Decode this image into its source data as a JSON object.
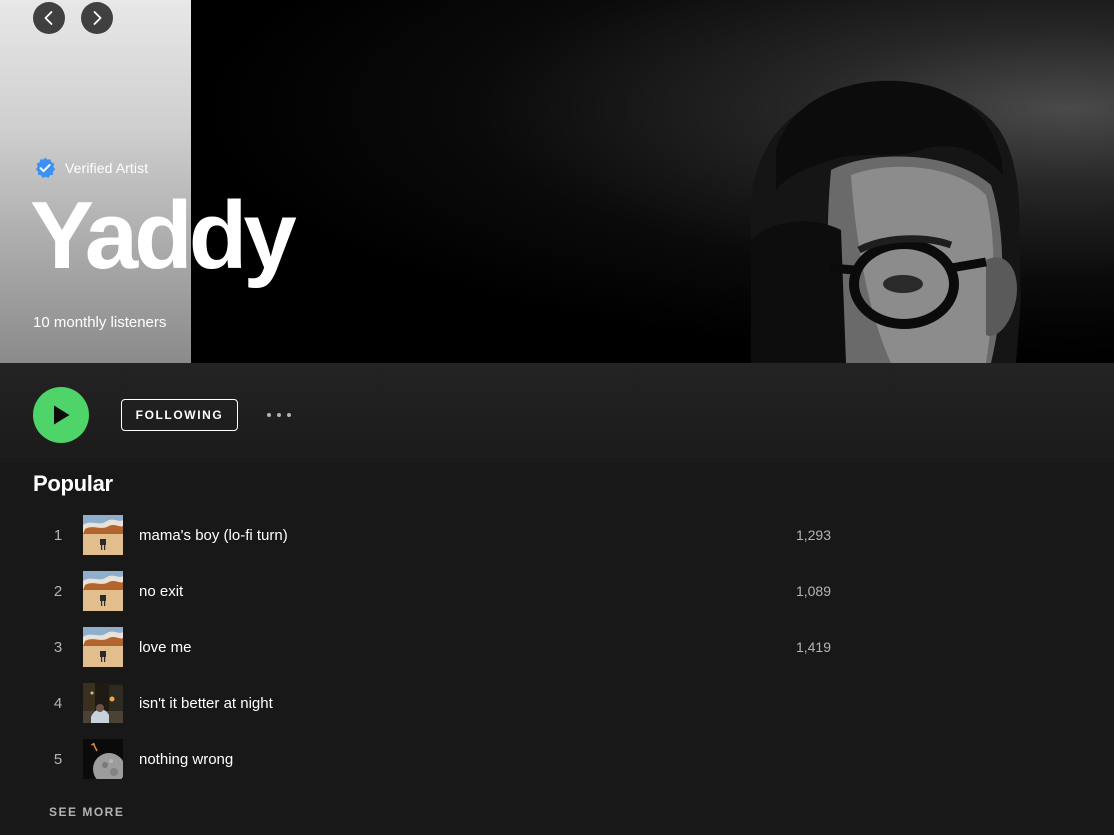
{
  "header": {
    "verified_label": "Verified Artist",
    "artist_name": "Yaddy",
    "monthly_listeners": "10 monthly listeners"
  },
  "actions": {
    "following_label": "FOLLOWING"
  },
  "popular": {
    "title": "Popular",
    "tracks": [
      {
        "number": "1",
        "title": "mama's boy (lo-fi turn)",
        "plays": "1,293",
        "art": "album-desert-art"
      },
      {
        "number": "2",
        "title": "no exit",
        "plays": "1,089",
        "art": "album-desert-art"
      },
      {
        "number": "3",
        "title": "love me",
        "plays": "1,419",
        "art": "album-desert-art"
      },
      {
        "number": "4",
        "title": "isn't it better at night",
        "plays": "",
        "art": "night-street-art"
      },
      {
        "number": "5",
        "title": "nothing wrong",
        "plays": "",
        "art": "moon-art"
      }
    ],
    "see_more_label": "SEE MORE"
  },
  "colors": {
    "background": "#181818",
    "play_button": "#4fd46a",
    "verified_badge": "#3d91f4",
    "muted_text": "#b3b3b3"
  },
  "icons": {
    "nav_back": "chevron-left-icon",
    "nav_forward": "chevron-right-icon",
    "verified": "verified-badge-icon",
    "play": "play-icon",
    "more": "more-options-icon"
  }
}
